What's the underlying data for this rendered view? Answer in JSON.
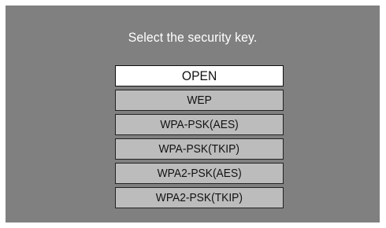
{
  "dialog": {
    "title": "Select the security key.",
    "options": [
      {
        "label": "OPEN",
        "selected": true
      },
      {
        "label": "WEP",
        "selected": false
      },
      {
        "label": "WPA-PSK(AES)",
        "selected": false
      },
      {
        "label": "WPA-PSK(TKIP)",
        "selected": false
      },
      {
        "label": "WPA2-PSK(AES)",
        "selected": false
      },
      {
        "label": "WPA2-PSK(TKIP)",
        "selected": false
      }
    ]
  },
  "colors": {
    "screen_background": "#808080",
    "option_background": "#bcbcbc",
    "selected_background": "#ffffff",
    "title_text": "#ffffff"
  }
}
